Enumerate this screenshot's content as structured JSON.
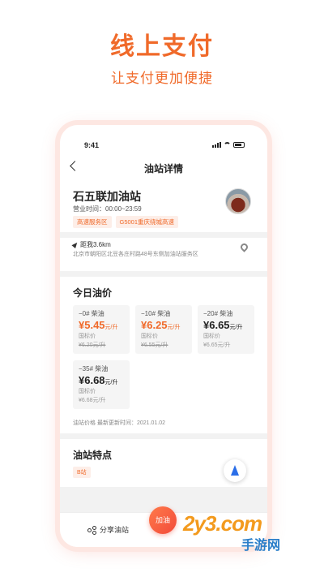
{
  "promo": {
    "title": "线上支付",
    "subtitle": "让支付更加便捷"
  },
  "status_bar": {
    "time": "9:41"
  },
  "header": {
    "title": "油站详情"
  },
  "station": {
    "name": "石五联加油站",
    "hours": "营业时间：00:00~23:59",
    "tags": [
      "高速服务区",
      "G5001重庆绕城高速"
    ],
    "distance": "距我3.6km",
    "address": "北京市朝阳区北豆各庄村路48号东侧加油站服务区"
  },
  "prices": {
    "section_title": "今日油价",
    "items": [
      {
        "grade": "−0# 柴油",
        "price": "¥5.45",
        "unit": "元/升",
        "national_label": "国标价",
        "national_price": "¥6.20元/升"
      },
      {
        "grade": "−10# 柴油",
        "price": "¥6.25",
        "unit": "元/升",
        "national_label": "国标价",
        "national_price": "¥6.55元/升"
      },
      {
        "grade": "−20# 柴油",
        "price": "¥6.65",
        "unit": "元/升",
        "national_label": "国标价",
        "national_price": "¥6.65元/升"
      },
      {
        "grade": "−35# 柴油",
        "price": "¥6.68",
        "unit": "元/升",
        "national_label": "国标价",
        "national_price": "¥6.68元/升"
      }
    ],
    "update_note": "油站价格  最新更新时间：2021.01.02"
  },
  "features": {
    "section_title": "油站特点",
    "tag": "B站"
  },
  "bottom_bar": {
    "share_label": "分享油站",
    "fuel_label": "加油"
  },
  "watermark": {
    "main": "2y3.com",
    "sub": "手游网"
  },
  "colors": {
    "accent": "#f06a2a",
    "compass": "#2a6ee8"
  }
}
